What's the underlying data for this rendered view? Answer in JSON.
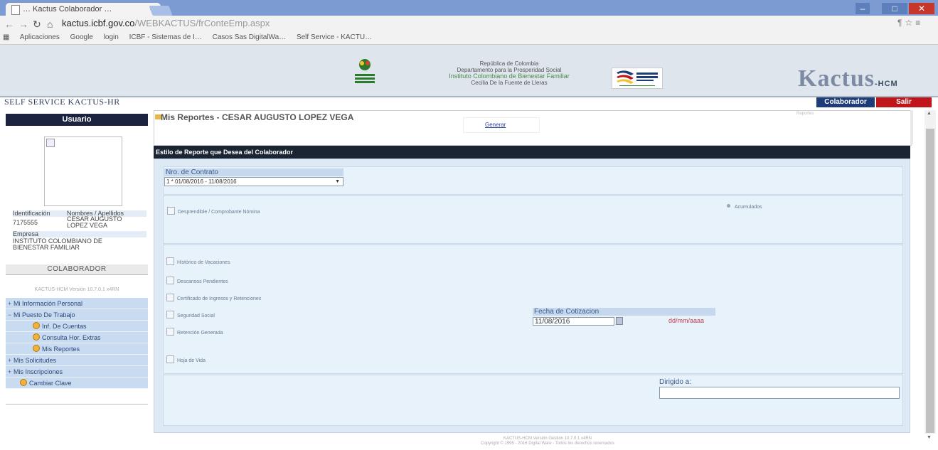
{
  "browser": {
    "tab_title": "… Kactus Colaborador …",
    "url_domain": "kactus.icbf.gov.co",
    "url_path": "/WEBKACTUS/frConteEmp.aspx",
    "bookmarks": [
      "Aplicaciones",
      "Google",
      "login",
      "ICBF - Sistemas de I…",
      "Casos Sas DigitalWa…",
      "Self Service - KACTU…"
    ]
  },
  "header": {
    "inst_line1": "República de Colombia",
    "inst_line2": "Departamento para la Prosperidad Social",
    "inst_name": "Instituto Colombiano de Bienestar Familiar",
    "inst_line3": "Cecilia De la Fuente de Lleras",
    "brand": "Kactus",
    "brand_suffix": "-HCM"
  },
  "nav": {
    "self_service": "SELF SERVICE  KACTUS-HR",
    "colaborador": "Colaborador",
    "salir": "Salir"
  },
  "sidebar": {
    "usuario_title": "Usuario",
    "id_label": "Identificación",
    "names_label": "Nombres / Apellidos",
    "id_value": "7175555",
    "name_value_1": "CESAR AUGUSTO",
    "name_value_2": "LOPEZ VEGA",
    "empresa_label": "Empresa",
    "empresa_value_1": "INSTITUTO COLOMBIANO DE",
    "empresa_value_2": "BIENESTAR FAMILIAR",
    "colaboradores_title": "COLABORADOR",
    "version": "KACTUS-HCM Versión 10.7.0.1 x4RN",
    "menu": [
      {
        "label": "Mi Información Personal",
        "type": "plus"
      },
      {
        "label": "Mi Puesto De Trabajo",
        "type": "minus"
      },
      {
        "label": "Inf. De Cuentas",
        "type": "leaf"
      },
      {
        "label": "Consulta Hor. Extras",
        "type": "leaf"
      },
      {
        "label": "Mis Reportes",
        "type": "leaf"
      },
      {
        "label": "Mis Solicitudes",
        "type": "plus"
      },
      {
        "label": "Mis Inscripciones",
        "type": "plus"
      },
      {
        "label": "Cambiar Clave",
        "type": "leaf2"
      }
    ]
  },
  "main": {
    "title": "Mis Reportes - CESAR AUGUSTO LOPEZ VEGA",
    "generar": "Generar",
    "reportes_tiny": "Reportes",
    "panel_title": "Estilo de Reporte que Desea del Colaborador",
    "contrato_label": "Nro. de Contrato",
    "contrato_value": "1 * 01/08/2016 - 11/08/2016",
    "desprendible": "Desprendible / Comprobante Nómina",
    "acumulados": "Acumulados",
    "checks": [
      "Histórico de Vacaciones",
      "Descansos Pendientes",
      "Certificado de Ingresos y Retenciones",
      "Seguridad Social",
      "Retención Generada",
      "Hoja de Vida"
    ],
    "fecha_label": "Fecha de Cotizacion",
    "fecha_value": "11/08/2016",
    "fecha_format": "dd/mm/aaaa",
    "dirigido_label": "Dirigido a:",
    "dirigido_value": ""
  },
  "footer": {
    "line1": "KACTUS-HCM Versión Gestión 10.7.0.1 x4RN",
    "line2": "Copyright © 1995 - 2016  Digital Ware - Todos los derechos reservados"
  },
  "colors": {
    "chrome_blue": "#7c9bd2",
    "colaborador_btn": "#1e3c78",
    "salir_btn": "#c0161a",
    "panel_head": "#1a2433",
    "panel_bg": "#dde9f4",
    "menu_bg": "#c9dbf0"
  }
}
